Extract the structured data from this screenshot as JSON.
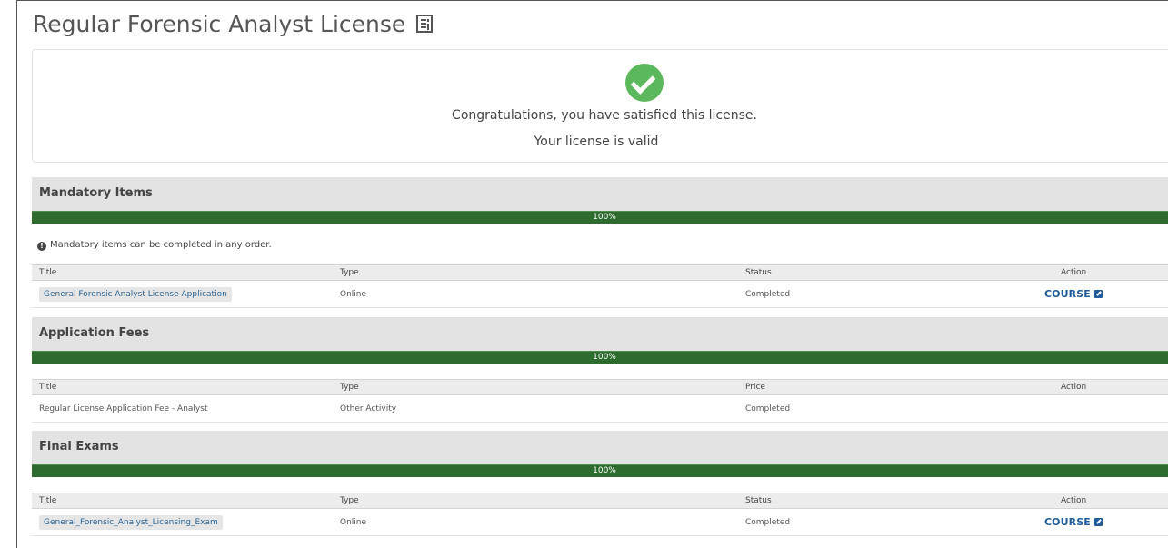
{
  "page": {
    "title": "Regular Forensic Analyst License",
    "title_icon": "list-document-icon"
  },
  "status_panel": {
    "icon": "check-circle-icon",
    "icon_color": "#5cb85c",
    "message": "Congratulations, you have satisfied this license.",
    "validity": "Your license is valid"
  },
  "colors": {
    "progress": "#2e6b2e",
    "link": "#1f5c99",
    "section_bg": "#e3e3e3"
  },
  "sections": {
    "mandatory": {
      "heading": "Mandatory Items",
      "progress_label": "100%",
      "progress_value": 100,
      "note": "Mandatory items can be completed in any order.",
      "note_icon": "info-circle-icon",
      "columns": [
        "Title",
        "Type",
        "Status",
        "Action"
      ],
      "rows": [
        {
          "title": "General Forensic Analyst License Application",
          "type": "Online",
          "status": "Completed",
          "action": "COURSE",
          "action_icon": "edit-icon"
        }
      ]
    },
    "fees": {
      "heading": "Application Fees",
      "progress_label": "100%",
      "progress_value": 100,
      "columns": [
        "Title",
        "Type",
        "Price",
        "Action"
      ],
      "rows": [
        {
          "title": "Regular License Application Fee - Analyst",
          "type": "Other Activity",
          "status": "Completed",
          "action": ""
        }
      ]
    },
    "exams": {
      "heading": "Final Exams",
      "progress_label": "100%",
      "progress_value": 100,
      "columns": [
        "Title",
        "Type",
        "Status",
        "Action"
      ],
      "rows": [
        {
          "title": "General_Forensic_Analyst_Licensing_Exam",
          "type": "Online",
          "status": "Completed",
          "action": "COURSE",
          "action_icon": "edit-icon"
        }
      ]
    }
  }
}
